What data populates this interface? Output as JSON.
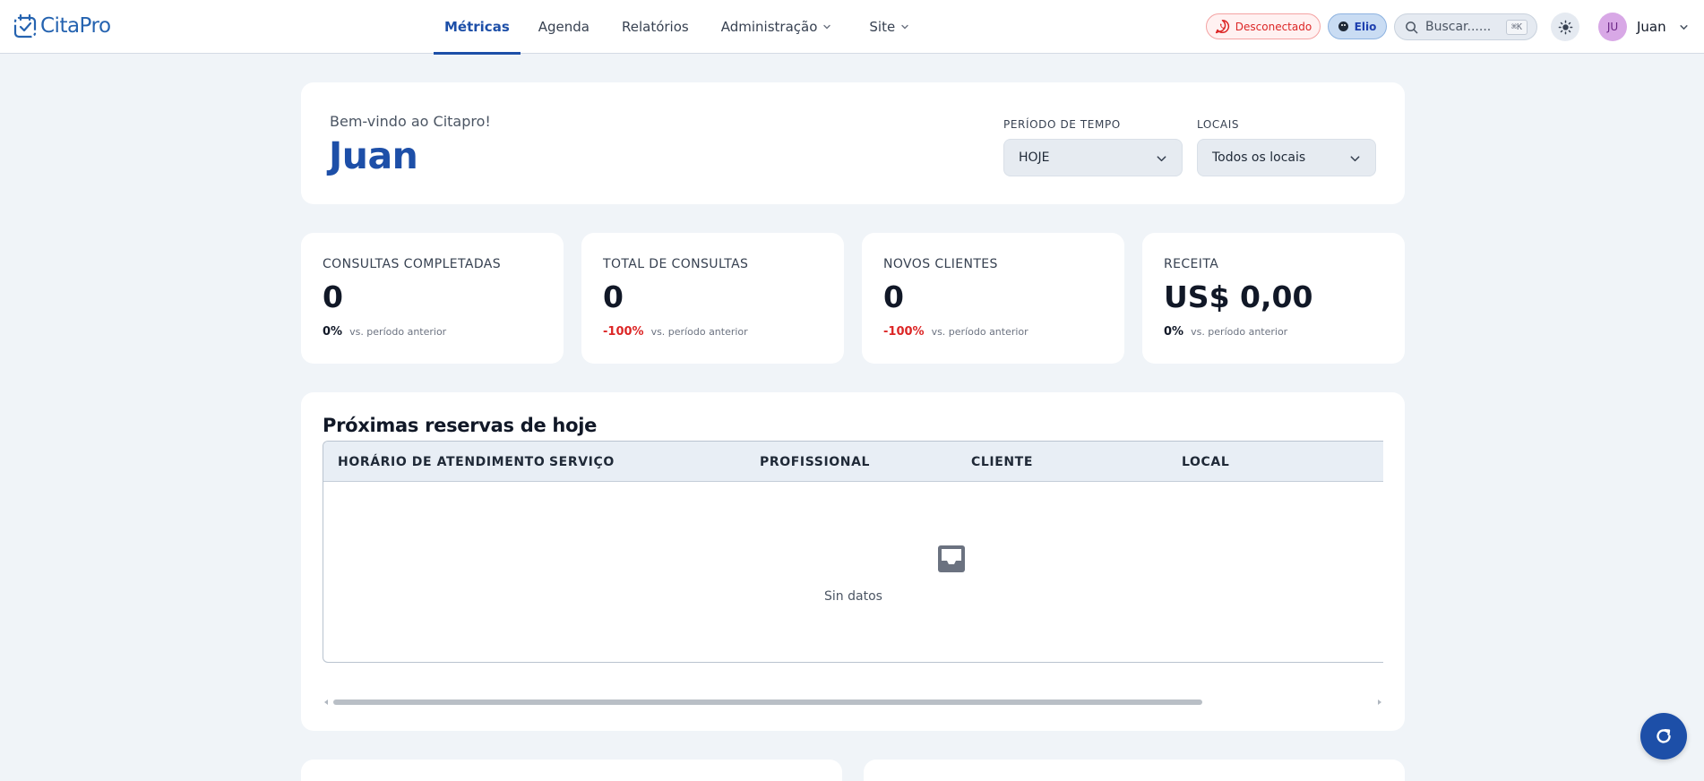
{
  "brand": {
    "name": "CitaPro",
    "primary_color": "#1d4fa8"
  },
  "nav": {
    "links": [
      {
        "label": "Métricas",
        "active": true,
        "has_dropdown": false
      },
      {
        "label": "Agenda",
        "active": false,
        "has_dropdown": false
      },
      {
        "label": "Relatórios",
        "active": false,
        "has_dropdown": false
      },
      {
        "label": "Administração",
        "active": false,
        "has_dropdown": true
      },
      {
        "label": "Site",
        "active": false,
        "has_dropdown": true
      }
    ],
    "status_label": "Desconectado",
    "status_icon": "whatsapp-icon",
    "assistant_label": "Elio",
    "search_placeholder": "Buscar......",
    "search_shortcut": "⌘K",
    "theme_icon": "sun-icon",
    "user": {
      "initials": "JU",
      "name": "Juan"
    }
  },
  "welcome": {
    "subtitle": "Bem-vindo ao Citapro!",
    "name": "Juan",
    "period_label": "PERÍODO DE TEMPO",
    "period_value": "HOJE",
    "locations_label": "LOCAIS",
    "locations_value": "Todos os locais"
  },
  "kpis": [
    {
      "label": "CONSULTAS COMPLETADAS",
      "value": "0",
      "delta": "0%",
      "delta_color": "#111827",
      "vs": "vs. período anterior"
    },
    {
      "label": "TOTAL DE CONSULTAS",
      "value": "0",
      "delta": "-100%",
      "delta_color": "#dc2626",
      "vs": "vs. período anterior"
    },
    {
      "label": "NOVOS CLIENTES",
      "value": "0",
      "delta": "-100%",
      "delta_color": "#dc2626",
      "vs": "vs. período anterior"
    },
    {
      "label": "RECEITA",
      "value": "US$ 0,00",
      "delta": "0%",
      "delta_color": "#111827",
      "vs": "vs. período anterior"
    }
  ],
  "bookings": {
    "title": "Próximas reservas de hoje",
    "columns": [
      "HORÁRIO DE ATENDIMENTO",
      "SERVIÇO",
      "PROFISSIONAL",
      "CLIENTE",
      "LOCAL"
    ],
    "rows": [],
    "empty_text": "Sin datos",
    "empty_icon": "inbox-icon"
  },
  "refresh_icon": "refresh-icon"
}
